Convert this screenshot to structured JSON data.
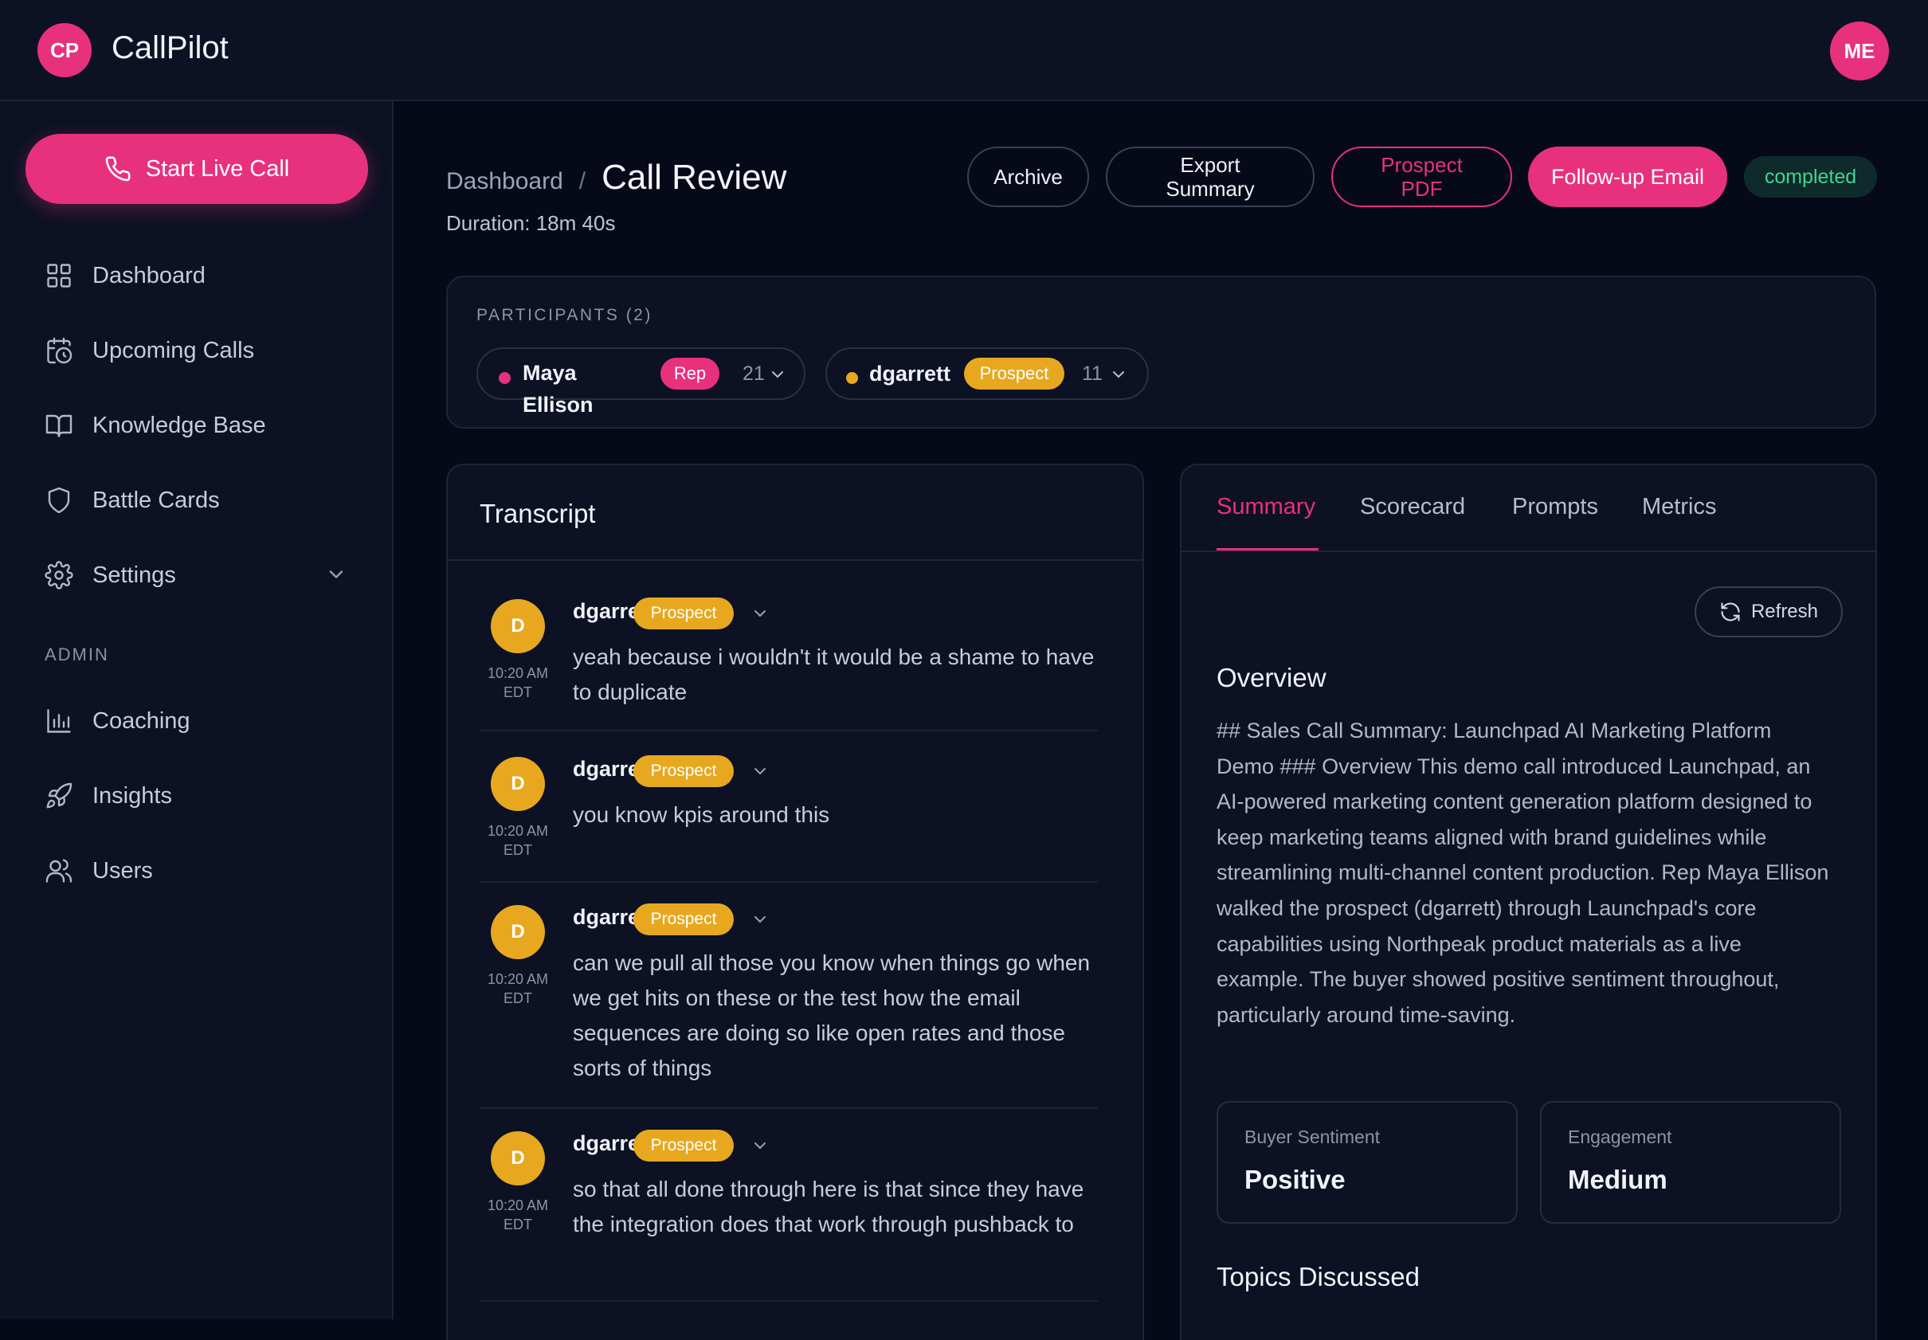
{
  "app": {
    "logo_initials": "CP",
    "title": "CallPilot",
    "user_initials": "ME"
  },
  "sidebar": {
    "live_button": "Start Live Call",
    "items": [
      {
        "label": "Dashboard",
        "icon": "grid-icon"
      },
      {
        "label": "Upcoming Calls",
        "icon": "calendar-clock-icon"
      },
      {
        "label": "Knowledge Base",
        "icon": "book-icon"
      },
      {
        "label": "Battle Cards",
        "icon": "shield-icon"
      },
      {
        "label": "Settings",
        "icon": "gear-icon"
      }
    ],
    "admin_label": "ADMIN",
    "admin_items": [
      {
        "label": "Coaching",
        "icon": "bar-chart-icon"
      },
      {
        "label": "Insights",
        "icon": "rocket-icon"
      },
      {
        "label": "Users",
        "icon": "users-icon"
      }
    ]
  },
  "header": {
    "breadcrumb_root": "Dashboard",
    "breadcrumb_sep": "/",
    "title": "Call Review",
    "duration": "Duration: 18m 40s",
    "buttons": {
      "archive": "Archive",
      "export_line1": "Export",
      "export_line2": "Summary",
      "prospect_line1": "Prospect",
      "prospect_line2": "PDF",
      "followup": "Follow-up Email"
    },
    "status": "completed"
  },
  "participants": {
    "title": "PARTICIPANTS (2)",
    "list": [
      {
        "name_line1": "Maya",
        "name_line2": "Ellison",
        "role": "Rep",
        "count": "21",
        "dot_color": "#e8317d"
      },
      {
        "name": "dgarrett",
        "role": "Prospect",
        "count": "11",
        "dot_color": "#e7a820"
      }
    ]
  },
  "transcript": {
    "title": "Transcript",
    "messages": [
      {
        "initial": "D",
        "name": "dgarrett",
        "role": "Prospect",
        "time_line1": "10:20 AM",
        "time_line2": "EDT",
        "text": "yeah because i wouldn't it would be a shame to have to duplicate"
      },
      {
        "initial": "D",
        "name": "dgarrett",
        "role": "Prospect",
        "time_line1": "10:20 AM",
        "time_line2": "EDT",
        "text": "you know kpis around this"
      },
      {
        "initial": "D",
        "name": "dgarrett",
        "role": "Prospect",
        "time_line1": "10:20 AM",
        "time_line2": "EDT",
        "text": "can we pull all those you know when things go when we get hits on these or the test how the email sequences are doing so like open rates and those sorts of things"
      },
      {
        "initial": "D",
        "name": "dgarrett",
        "role": "Prospect",
        "time_line1": "10:20 AM",
        "time_line2": "EDT",
        "text": "so that all done through here is that since they have the integration does that work through pushback to"
      }
    ]
  },
  "panel": {
    "tabs": [
      "Summary",
      "Scorecard",
      "Prompts",
      "Metrics"
    ],
    "active_tab": "Summary",
    "refresh": "Refresh",
    "overview_title": "Overview",
    "overview_text": "## Sales Call Summary: Launchpad AI Marketing Platform Demo ### Overview This demo call introduced Launchpad, an AI-powered marketing content generation platform designed to keep marketing teams aligned with brand guidelines while streamlining multi-channel content production. Rep Maya Ellison walked the prospect (dgarrett) through Launchpad's core capabilities using Northpeak product materials as a live example. The buyer showed positive sentiment throughout, particularly around time-saving.",
    "metrics": [
      {
        "label": "Buyer Sentiment",
        "value": "Positive"
      },
      {
        "label": "Engagement",
        "value": "Medium"
      }
    ],
    "topics_title": "Topics Discussed"
  },
  "colors": {
    "accent": "#e8317d",
    "prospect": "#e7a820",
    "status_green": "#3ed68f"
  }
}
